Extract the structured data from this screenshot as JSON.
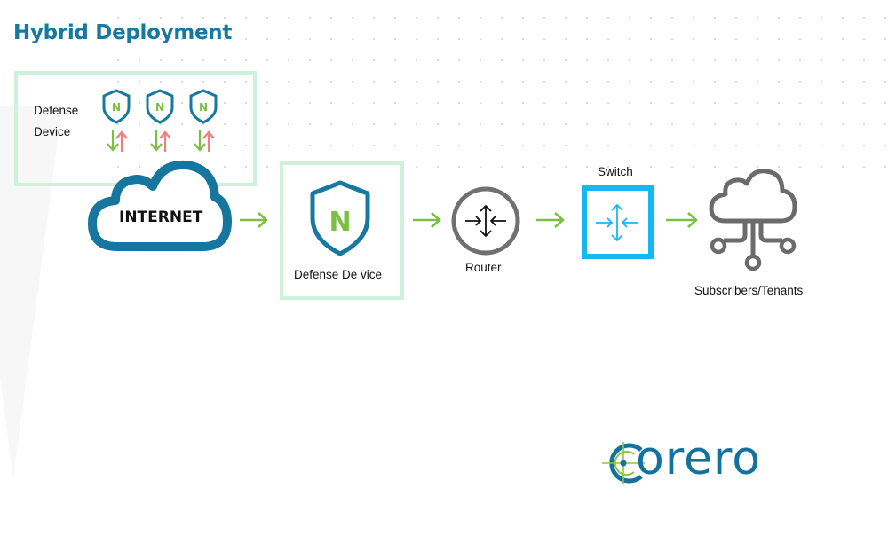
{
  "title": "Hybrid Deployment",
  "colors": {
    "brand_blue": "#1778a0",
    "arrow_green": "#7ac143",
    "arrow_red": "#f08080",
    "switch_cyan": "#17b8f2",
    "router_grey": "#707070",
    "box_mint": "#cdf1dc"
  },
  "cloud_defense_group": {
    "label_line1": "Defense",
    "label_line2": "Device",
    "shields": [
      {
        "icon": "shield-n-icon",
        "letter": "N"
      },
      {
        "icon": "shield-n-icon",
        "letter": "N"
      },
      {
        "icon": "shield-n-icon",
        "letter": "N"
      }
    ],
    "traffic_icon": "down-up-arrows-icon"
  },
  "flow": {
    "internet": {
      "label": "INTERNET",
      "icon": "cloud-icon"
    },
    "defense_device": {
      "label": "Defense De vice",
      "icon": "shield-n-icon",
      "letter": "N"
    },
    "router": {
      "label": "Router",
      "icon": "router-icon"
    },
    "switch": {
      "label": "Switch",
      "icon": "switch-icon"
    },
    "subscribers": {
      "label": "Subscribers/Tenants",
      "icon": "cloud-network-icon"
    },
    "connector_icon": "arrow-right-icon"
  },
  "logo": {
    "text": "orero",
    "icon": "crosshair-c-icon"
  }
}
